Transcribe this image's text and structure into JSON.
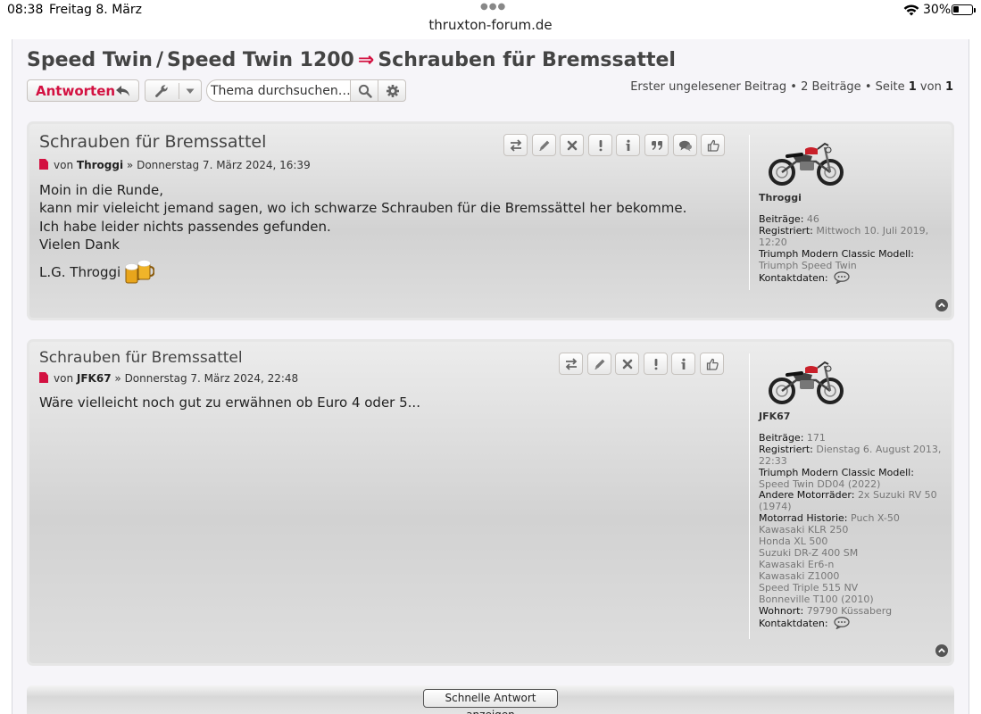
{
  "status_bar": {
    "time": "08:38",
    "date": "Freitag 8. März",
    "url": "thruxton-forum.de",
    "battery": "30%",
    "battery_level": 0.3
  },
  "breadcrumb": {
    "part1": "Speed Twin",
    "sep": "/",
    "part2": "Speed Twin 1200",
    "arrow": "⇒",
    "part3": "Schrauben für Bremssattel"
  },
  "actions": {
    "reply_label": "Antworten",
    "search_placeholder": "Thema durchsuchen…",
    "pagination": {
      "first_unread": "Erster ungelesener Beitrag",
      "bullet": "•",
      "posts": "2 Beiträge",
      "page_label": "Seite",
      "page": "1",
      "of": "von",
      "total": "1"
    }
  },
  "posts": [
    {
      "title": "Schrauben für Bremssattel",
      "by": "von",
      "author": "Throggi",
      "raquo": "»",
      "date": "Donnerstag 7. März 2024, 16:39",
      "body": [
        "Moin in die Runde,",
        "kann mir vieleicht jemand sagen, wo ich schwarze Schrauben für die Bremssättel her bekomme.",
        "Ich habe leider nichts passendes gefunden.",
        "Vielen Dank"
      ],
      "signature": "L.G. Throggi",
      "buttons": [
        "swap-icon",
        "pencil-icon",
        "delete-icon",
        "report-icon",
        "info-icon",
        "quote-icon",
        "chat-icon",
        "thumbs-up-icon"
      ],
      "profile": {
        "username": "Throggi",
        "fields": [
          {
            "label": "Beiträge:",
            "value": "46"
          },
          {
            "label": "Registriert:",
            "value": "Mittwoch 10. Juli 2019, 12:20"
          },
          {
            "label": "Triumph Modern Classic Modell:",
            "value": "Triumph Speed Twin"
          },
          {
            "label": "Kontaktdaten:",
            "value": ""
          }
        ]
      }
    },
    {
      "title": "Schrauben für Bremssattel",
      "by": "von",
      "author": "JFK67",
      "raquo": "»",
      "date": "Donnerstag 7. März 2024, 22:48",
      "body": [
        "Wäre vielleicht noch gut zu erwähnen ob Euro 4 oder 5..."
      ],
      "buttons": [
        "swap-icon",
        "pencil-icon",
        "delete-icon",
        "report-icon",
        "info-icon",
        "thumbs-up-icon"
      ],
      "profile": {
        "username": "JFK67",
        "fields": [
          {
            "label": "Beiträge:",
            "value": "171"
          },
          {
            "label": "Registriert:",
            "value": "Dienstag 6. August 2013, 22:33"
          },
          {
            "label": "Triumph Modern Classic Modell:",
            "value": "Speed Twin DD04 (2022)"
          },
          {
            "label": "Andere Motorräder:",
            "value": "2x Suzuki RV 50 (1974)"
          },
          {
            "label": "Motorrad Historie:",
            "value": "Puch X-50\nKawasaki KLR 250\nHonda XL 500\nSuzuki DR-Z 400 SM\nKawasaki Er6-n\nKawasaki Z1000\nSpeed Triple 515 NV\nBonneville T100 (2010)"
          },
          {
            "label": "Wohnort:",
            "value": "79790 Küssaberg"
          },
          {
            "label": "Kontaktdaten:",
            "value": ""
          }
        ]
      }
    }
  ],
  "quick_reply_label": "Schnelle Antwort anzeigen",
  "colors": {
    "accent": "#d31141",
    "text": "#333333",
    "muted": "#777777"
  }
}
